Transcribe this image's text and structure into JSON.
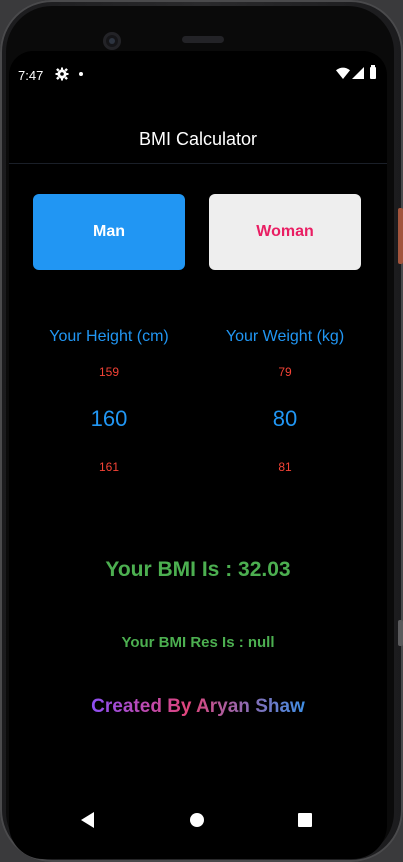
{
  "status": {
    "time": "7:47"
  },
  "appbar": {
    "title": "BMI Calculator"
  },
  "gender": {
    "man_label": "Man",
    "woman_label": "Woman"
  },
  "height": {
    "label": "Your Height (cm)",
    "prev": "159",
    "selected": "160",
    "next": "161"
  },
  "weight": {
    "label": "Your Weight (kg)",
    "prev": "79",
    "selected": "80",
    "next": "81"
  },
  "result": {
    "bmi_text": "Your BMI Is : 32.03",
    "res_text": "Your BMI Res Is : null"
  },
  "credit": {
    "text": "Created By Aryan Shaw"
  },
  "colors": {
    "accent_blue": "#2196f3",
    "woman_pink": "#e91e63",
    "result_green": "#4caf50",
    "picker_red": "#f44336"
  },
  "icons": [
    "settings-gear-icon",
    "notification-dot-icon",
    "wifi-icon",
    "cell-signal-icon",
    "battery-icon",
    "back-icon",
    "home-icon",
    "recents-icon"
  ]
}
